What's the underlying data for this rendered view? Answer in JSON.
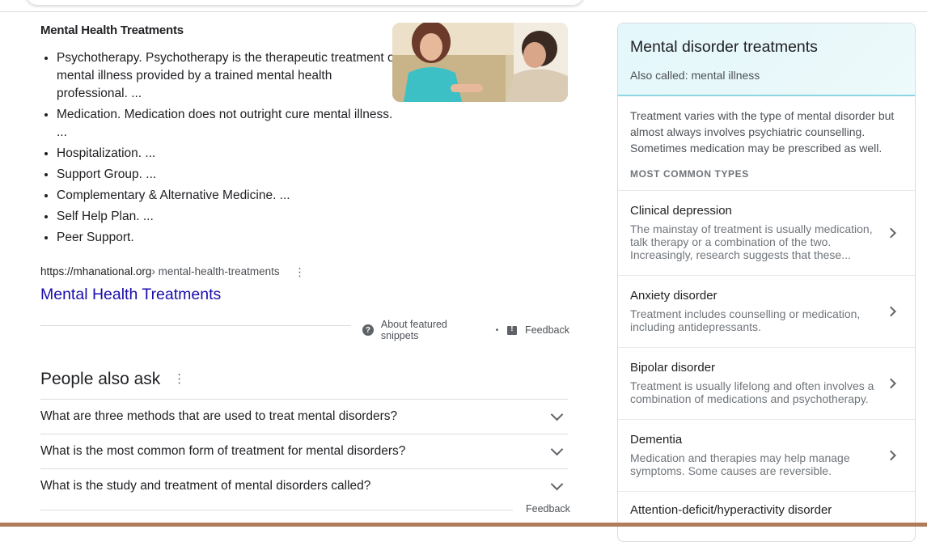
{
  "snippet": {
    "title": "Mental Health Treatments",
    "items": [
      "Psychotherapy. Psychotherapy is the therapeutic treatment of mental illness provided by a trained mental health professional. ...",
      "Medication. Medication does not outright cure mental illness. ...",
      "Hospitalization. ...",
      "Support Group. ...",
      "Complementary & Alternative Medicine. ...",
      "Self Help Plan. ...",
      "Peer Support."
    ],
    "cite_domain": "https://mhanational.org",
    "cite_path": " › mental-health-treatments",
    "link_text": "Mental Health Treatments",
    "about_label": "About featured snippets",
    "feedback_label": "Feedback"
  },
  "people_also_ask": {
    "title": "People also ask",
    "questions": [
      "What are three methods that are used to treat mental disorders?",
      "What is the most common form of treatment for mental disorders?",
      "What is the study and treatment of mental disorders called?"
    ],
    "feedback_label": "Feedback"
  },
  "knowledge_panel": {
    "title": "Mental disorder treatments",
    "alias": "Also called: mental illness",
    "description": "Treatment varies with the type of mental disorder but almost always involves psychiatric counselling. Sometimes medication may be prescribed as well.",
    "types_label": "MOST COMMON TYPES",
    "types": [
      {
        "name": "Clinical depression",
        "desc": "The mainstay of treatment is usually medication, talk therapy or a combination of the two. Increasingly, research suggests that these..."
      },
      {
        "name": "Anxiety disorder",
        "desc": "Treatment includes counselling or medication, including antidepressants."
      },
      {
        "name": "Bipolar disorder",
        "desc": "Treatment is usually lifelong and often involves a combination of medications and psychotherapy."
      },
      {
        "name": "Dementia",
        "desc": "Medication and therapies may help manage symptoms. Some causes are reversible."
      },
      {
        "name": "Attention-deficit/hyperactivity disorder",
        "desc": ""
      }
    ]
  },
  "colors": {
    "link": "#1a0dab",
    "panel_accent": "#8ed6e4"
  }
}
